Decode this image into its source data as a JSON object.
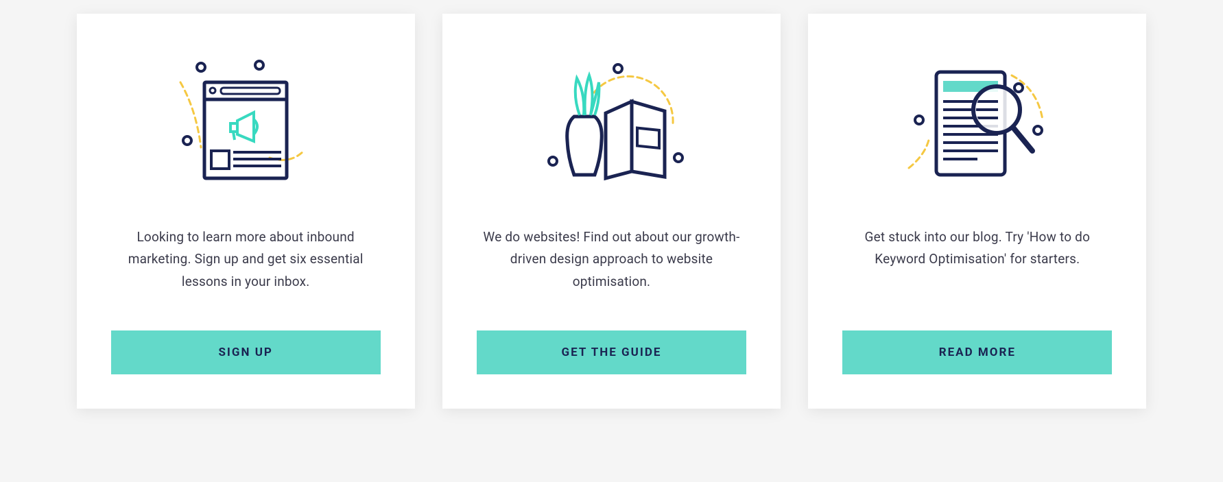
{
  "colors": {
    "accent": "#63d9c9",
    "navy": "#1a2352",
    "yellow": "#f5c842",
    "text": "#3a3a4a"
  },
  "cards": [
    {
      "icon": "megaphone-window-icon",
      "description": "Looking to learn more about inbound marketing. Sign up and get six essential lessons in your inbox.",
      "button_label": "SIGN UP"
    },
    {
      "icon": "book-plant-icon",
      "description": "We do websites! Find out about our growth-driven design approach to website optimisation.",
      "button_label": "GET THE GUIDE"
    },
    {
      "icon": "tablet-magnifier-icon",
      "description": "Get stuck into our blog. Try 'How to do Keyword Optimisation' for starters.",
      "button_label": "READ MORE"
    }
  ]
}
